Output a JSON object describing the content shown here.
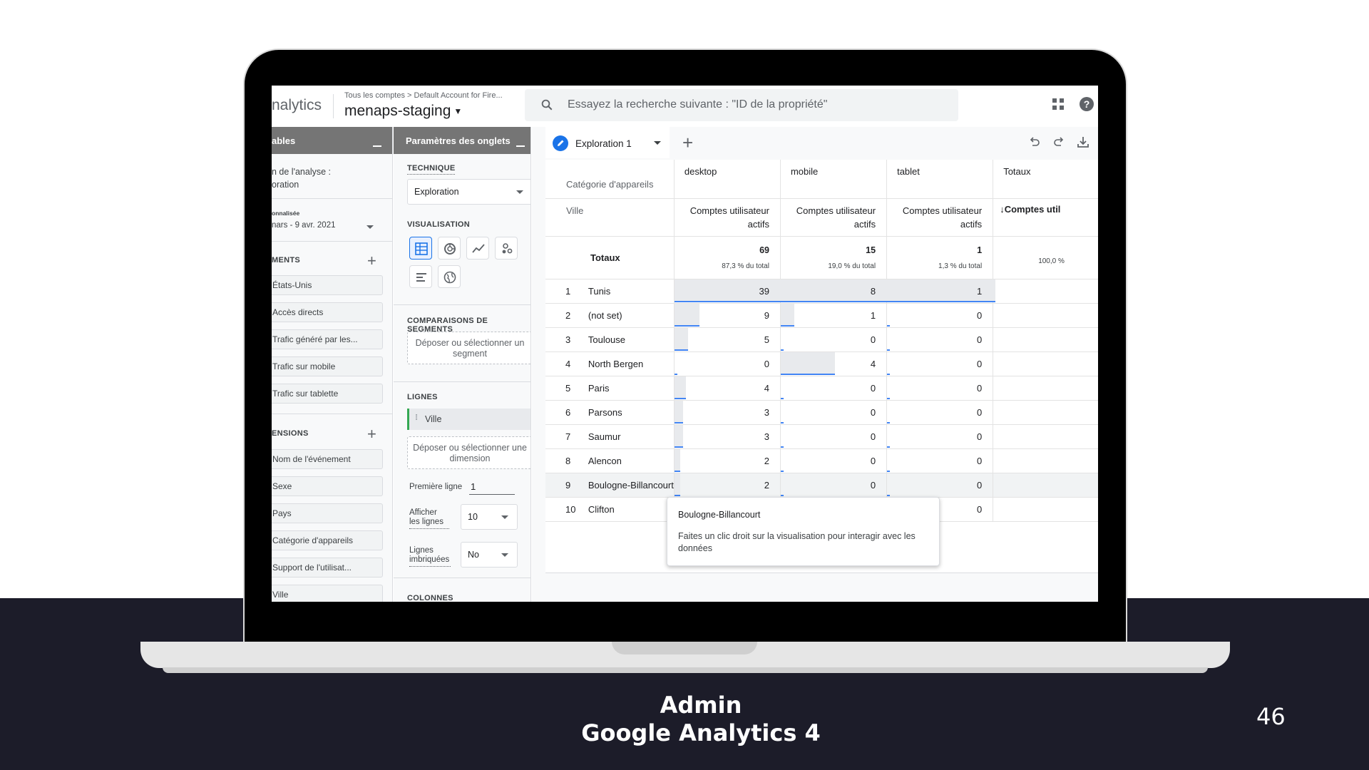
{
  "slide": {
    "title_line1": "Admin",
    "title_line2": "Google Analytics 4",
    "page_number": "46"
  },
  "topbar": {
    "brand": "nalytics",
    "breadcrumb": "Tous les comptes > Default Account for Fire...",
    "property": "menaps-staging",
    "search_placeholder": "Essayez la recherche suivante : \"ID de la propriété\""
  },
  "variables_panel": {
    "title": "ables",
    "analysis_name_label": "n de l'analyse :",
    "analysis_name_value": "oration",
    "date_label": "onnalisée",
    "date_value": "nars - 9 avr. 2021",
    "segments_title": "MENTS",
    "segments": [
      "États-Unis",
      "Accès directs",
      "Trafic généré par les...",
      "Trafic sur mobile",
      "Trafic sur tablette"
    ],
    "dimensions_title": "ENSIONS",
    "dimensions": [
      "Nom de l'événement",
      "Sexe",
      "Pays",
      "Catégorie d'appareils",
      "Support de l'utilisat...",
      "Ville"
    ]
  },
  "settings_panel": {
    "title": "Paramètres des onglets",
    "technique_label": "TECHNIQUE",
    "technique_value": "Exploration",
    "visualization_label": "VISUALISATION",
    "viz_icons": [
      "table-icon",
      "donut-chart-icon",
      "line-chart-icon",
      "scatter-icon",
      "bar-chart-icon",
      "globe-icon"
    ],
    "segment_comparisons_label": "COMPARAISONS DE SEGMENTS",
    "segment_drop": "Déposer ou sélectionner un segment",
    "rows_label": "LIGNES",
    "row_dimension": "Ville",
    "dimension_drop": "Déposer ou sélectionner une dimension",
    "first_row_label": "Première ligne",
    "first_row_value": "1",
    "show_rows_label": "Afficher les lignes",
    "show_rows_value": "10",
    "nested_rows_label": "Lignes imbriquées",
    "nested_rows_value": "No",
    "columns_label": "COLONNES"
  },
  "exploration": {
    "tab_label": "Exploration 1",
    "col_dim_label": "Catégorie d'appareils",
    "row_dim_label": "Ville",
    "columns": [
      "desktop",
      "mobile",
      "tablet",
      "Totaux"
    ],
    "metric_label_line1": "Comptes utilisateur",
    "metric_label_line2": "actifs",
    "totals_metric_label": "↓Comptes util",
    "totals_label": "Totaux",
    "totals": [
      {
        "value": "69",
        "pct": "87,3 % du total"
      },
      {
        "value": "15",
        "pct": "19,0 % du total"
      },
      {
        "value": "1",
        "pct": "1,3 % du total"
      },
      {
        "value": "",
        "pct": "100,0 %"
      }
    ],
    "rows": [
      {
        "idx": "1",
        "city": "Tunis",
        "desktop": "39",
        "mobile": "8",
        "tablet": "1"
      },
      {
        "idx": "2",
        "city": "(not set)",
        "desktop": "9",
        "mobile": "1",
        "tablet": "0"
      },
      {
        "idx": "3",
        "city": "Toulouse",
        "desktop": "5",
        "mobile": "0",
        "tablet": "0"
      },
      {
        "idx": "4",
        "city": "North Bergen",
        "desktop": "0",
        "mobile": "4",
        "tablet": "0"
      },
      {
        "idx": "5",
        "city": "Paris",
        "desktop": "4",
        "mobile": "0",
        "tablet": "0"
      },
      {
        "idx": "6",
        "city": "Parsons",
        "desktop": "3",
        "mobile": "0",
        "tablet": "0"
      },
      {
        "idx": "7",
        "city": "Saumur",
        "desktop": "3",
        "mobile": "0",
        "tablet": "0"
      },
      {
        "idx": "8",
        "city": "Alencon",
        "desktop": "2",
        "mobile": "0",
        "tablet": "0"
      },
      {
        "idx": "9",
        "city": "Boulogne-Billancourt",
        "desktop": "2",
        "mobile": "0",
        "tablet": "0"
      },
      {
        "idx": "10",
        "city": "Clifton",
        "desktop": "",
        "mobile": "",
        "tablet": "0"
      }
    ],
    "tooltip_title": "Boulogne-Billancourt",
    "tooltip_body": "Faites un clic droit sur la visualisation pour interagir avec les données"
  },
  "colors": {
    "accent": "#1a73e8",
    "bar": "#4285f4",
    "footer": "#1c1c29"
  }
}
